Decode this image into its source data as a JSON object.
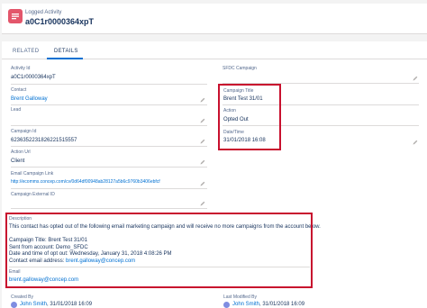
{
  "header": {
    "object_label": "Logged Activity",
    "record_name": "a0C1r0000364xpT"
  },
  "tabs": [
    {
      "label": "RELATED",
      "active": false
    },
    {
      "label": "DETAILS",
      "active": true
    }
  ],
  "left_fields": [
    {
      "label": "Activity Id",
      "value": "a0C1r0000364xpT"
    },
    {
      "label": "Contact",
      "value": "Brent Galloway"
    },
    {
      "label": "Lead",
      "value": ""
    },
    {
      "label": "Campaign Id",
      "value": "6236352231826221515557"
    },
    {
      "label": "Action Url",
      "value": "Client"
    },
    {
      "label": "Email Campaign Link",
      "value": "http://ecomms.concep.com/cv/0d64df00948ab28127a5b6c9760b3406ebfcf"
    },
    {
      "label": "Campaign External ID",
      "value": ""
    }
  ],
  "right_fields": [
    {
      "label": "SFDC Campaign",
      "value": ""
    },
    {
      "label": "Campaign Title",
      "value": "Brent Test 31/01"
    },
    {
      "label": "Action",
      "value": "Opted Out"
    },
    {
      "label": "Date/Time",
      "value": "31/01/2018 16:08"
    }
  ],
  "description": {
    "label": "Description",
    "lines": [
      "This contact has opted out of the following email marketing campaign and will receive no more campaigns from the account below.",
      "",
      "Campaign Title: Brent Test 31/01",
      "Sent from account: Demo_SFDC",
      "Date and time of opt out: Wednesday, January 31, 2018 4:08:26 PM"
    ],
    "contact_prefix": "Contact email address: ",
    "contact_email": "brent.galloway@concep.com"
  },
  "email": {
    "label": "Email",
    "value": "brent.galloway@concep.com"
  },
  "footer": {
    "created_label": "Created By",
    "created_user": "John Smith",
    "created_date": ", 31/01/2018 16:09",
    "modified_label": "Last Modified By",
    "modified_user": "John Smith",
    "modified_date": ", 31/01/2018 16:09"
  },
  "colors": {
    "highlight_box": "#c8102e",
    "object_icon": "#e3566b",
    "link": "#0070d2"
  },
  "icons": [
    "custom-object-icon",
    "pencil-icon"
  ]
}
